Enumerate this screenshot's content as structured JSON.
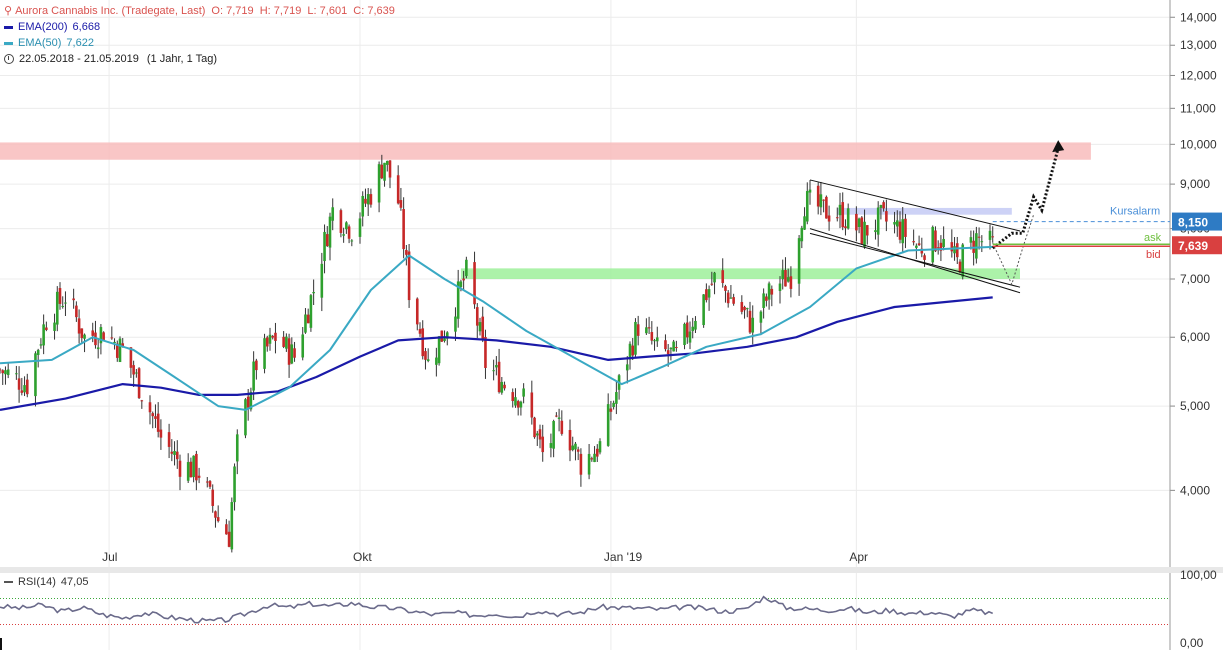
{
  "header": {
    "title": "Aurora Cannabis Inc. (Tradegate, Last)",
    "ohlc": "O: 7,719  H: 7,719  L: 7,601  C: 7,639",
    "ema200_label": "EMA(200)",
    "ema200_value": "6,668",
    "ema50_label": "EMA(50)",
    "ema50_value": "7,622",
    "date_range": "22.05.2018 - 21.05.2019",
    "period": "(1 Jahr, 1 Tag)"
  },
  "colors": {
    "title": "#d9534f",
    "ema200": "#1a1aa8",
    "ema50": "#3aa9c4",
    "up": "#2ea02e",
    "down": "#c62828",
    "resistance_zone": "#f8bcbc",
    "support_zone": "#9ef09a",
    "kursalarm": "#4a8fd8",
    "ask": "#6fbf3f",
    "bid": "#d94040",
    "rsi": "#6a6a8a"
  },
  "chart_data": [
    {
      "type": "candlestick",
      "title": "Aurora Cannabis Inc. (Tradegate, Last)",
      "y_scale": "log",
      "ylim": [
        3.3,
        14.5
      ],
      "y_ticks": [
        "14,000",
        "13,000",
        "12,000",
        "11,000",
        "10,000",
        "9,000",
        "8,000",
        "7,000",
        "6,000",
        "5,000",
        "4,000"
      ],
      "y_tick_values": [
        14,
        13,
        12,
        11,
        10,
        9,
        8,
        7,
        6,
        5,
        4
      ],
      "x_tick_labels": [
        "Jul",
        "Okt",
        "Jan '19",
        "Apr"
      ],
      "x_tick_dates": [
        "2018-07-01",
        "2018-10-01",
        "2019-01-01",
        "2019-04-01"
      ],
      "xlim": [
        "2018-05-22",
        "2019-07-25"
      ],
      "price_path": [
        [
          "2018-05-22",
          5.5
        ],
        [
          "2018-06-01",
          5.3
        ],
        [
          "2018-06-08",
          6.3
        ],
        [
          "2018-06-15",
          6.7
        ],
        [
          "2018-06-22",
          6.0
        ],
        [
          "2018-06-29",
          6.1
        ],
        [
          "2018-07-06",
          5.8
        ],
        [
          "2018-07-13",
          5.2
        ],
        [
          "2018-07-20",
          4.6
        ],
        [
          "2018-07-27",
          4.3
        ],
        [
          "2018-08-03",
          4.2
        ],
        [
          "2018-08-10",
          3.7
        ],
        [
          "2018-08-14",
          3.55
        ],
        [
          "2018-08-17",
          4.5
        ],
        [
          "2018-08-24",
          5.6
        ],
        [
          "2018-08-31",
          6.0
        ],
        [
          "2018-09-07",
          5.7
        ],
        [
          "2018-09-14",
          6.8
        ],
        [
          "2018-09-21",
          8.4
        ],
        [
          "2018-09-28",
          8.0
        ],
        [
          "2018-10-05",
          8.8
        ],
        [
          "2018-10-10",
          9.6
        ],
        [
          "2018-10-15",
          8.6
        ],
        [
          "2018-10-19",
          6.8
        ],
        [
          "2018-10-26",
          5.6
        ],
        [
          "2018-11-02",
          6.2
        ],
        [
          "2018-11-09",
          7.1
        ],
        [
          "2018-11-16",
          5.6
        ],
        [
          "2018-11-23",
          5.3
        ],
        [
          "2018-11-30",
          5.1
        ],
        [
          "2018-12-07",
          4.4
        ],
        [
          "2018-12-14",
          4.8
        ],
        [
          "2018-12-21",
          4.3
        ],
        [
          "2018-12-28",
          4.5
        ],
        [
          "2019-01-04",
          5.3
        ],
        [
          "2019-01-11",
          6.2
        ],
        [
          "2019-01-18",
          5.8
        ],
        [
          "2019-01-25",
          5.7
        ],
        [
          "2019-02-01",
          6.4
        ],
        [
          "2019-02-08",
          7.0
        ],
        [
          "2019-02-15",
          6.6
        ],
        [
          "2019-02-22",
          6.2
        ],
        [
          "2019-03-01",
          6.8
        ],
        [
          "2019-03-08",
          7.1
        ],
        [
          "2019-03-13",
          8.6
        ],
        [
          "2019-03-20",
          8.4
        ],
        [
          "2019-03-27",
          8.3
        ],
        [
          "2019-04-03",
          7.9
        ],
        [
          "2019-04-10",
          8.2
        ],
        [
          "2019-04-17",
          8.0
        ],
        [
          "2019-04-24",
          7.6
        ],
        [
          "2019-05-01",
          7.8
        ],
        [
          "2019-05-08",
          7.3
        ],
        [
          "2019-05-15",
          7.8
        ],
        [
          "2019-05-21",
          7.639
        ]
      ],
      "series": [
        {
          "name": "EMA(200)",
          "points": [
            [
              "2018-05-22",
              4.95
            ],
            [
              "2018-06-15",
              5.1
            ],
            [
              "2018-07-06",
              5.3
            ],
            [
              "2018-07-20",
              5.25
            ],
            [
              "2018-08-03",
              5.15
            ],
            [
              "2018-08-17",
              5.15
            ],
            [
              "2018-09-01",
              5.2
            ],
            [
              "2018-09-15",
              5.4
            ],
            [
              "2018-10-01",
              5.7
            ],
            [
              "2018-10-15",
              5.95
            ],
            [
              "2018-11-01",
              6.0
            ],
            [
              "2018-11-20",
              5.95
            ],
            [
              "2018-12-10",
              5.85
            ],
            [
              "2018-12-31",
              5.65
            ],
            [
              "2019-01-15",
              5.7
            ],
            [
              "2019-02-01",
              5.75
            ],
            [
              "2019-02-20",
              5.85
            ],
            [
              "2019-03-10",
              6.0
            ],
            [
              "2019-03-25",
              6.25
            ],
            [
              "2019-04-15",
              6.5
            ],
            [
              "2019-05-21",
              6.668
            ]
          ]
        },
        {
          "name": "EMA(50)",
          "points": [
            [
              "2018-05-22",
              5.6
            ],
            [
              "2018-06-10",
              5.65
            ],
            [
              "2018-06-25",
              6.0
            ],
            [
              "2018-07-10",
              5.8
            ],
            [
              "2018-07-25",
              5.4
            ],
            [
              "2018-08-10",
              5.0
            ],
            [
              "2018-08-20",
              4.95
            ],
            [
              "2018-09-05",
              5.25
            ],
            [
              "2018-09-20",
              5.8
            ],
            [
              "2018-10-05",
              6.8
            ],
            [
              "2018-10-19",
              7.45
            ],
            [
              "2018-11-01",
              7.0
            ],
            [
              "2018-11-15",
              6.6
            ],
            [
              "2018-12-01",
              6.1
            ],
            [
              "2018-12-20",
              5.65
            ],
            [
              "2019-01-05",
              5.3
            ],
            [
              "2019-01-20",
              5.55
            ],
            [
              "2019-02-05",
              5.85
            ],
            [
              "2019-02-25",
              6.05
            ],
            [
              "2019-03-15",
              6.5
            ],
            [
              "2019-04-01",
              7.2
            ],
            [
              "2019-04-20",
              7.55
            ],
            [
              "2019-05-21",
              7.622
            ]
          ]
        }
      ],
      "zones": [
        {
          "type": "resistance",
          "y_low": 9.6,
          "y_high": 10.05,
          "x_start": "2018-05-22",
          "x_end": "2019-06-26"
        },
        {
          "type": "support",
          "y_low": 7.0,
          "y_high": 7.2,
          "x_start": "2018-11-07",
          "x_end": "2019-05-31"
        },
        {
          "type": "target",
          "y_low": 8.3,
          "y_high": 8.45,
          "x_start": "2019-03-25",
          "x_end": "2019-05-28"
        }
      ],
      "channel": {
        "upper": [
          [
            "2019-03-15",
            9.1
          ],
          [
            "2019-05-31",
            7.95
          ]
        ],
        "lower": [
          [
            "2019-03-15",
            8.0
          ],
          [
            "2019-05-31",
            6.75
          ]
        ],
        "inner": [
          [
            "2019-03-15",
            7.9
          ],
          [
            "2019-05-31",
            6.85
          ]
        ]
      },
      "scenario_path": [
        [
          "2019-05-21",
          7.6
        ],
        [
          "2019-05-28",
          7.9
        ],
        [
          "2019-06-01",
          7.9
        ],
        [
          "2019-06-05",
          8.7
        ],
        [
          "2019-06-08",
          8.4
        ],
        [
          "2019-06-14",
          9.9
        ]
      ],
      "alt_path": [
        [
          "2019-05-21",
          7.7
        ],
        [
          "2019-05-28",
          6.9
        ],
        [
          "2019-06-01",
          7.6
        ],
        [
          "2019-06-05",
          8.3
        ]
      ],
      "price_lines": [
        {
          "label": "Kursalarm",
          "value": "8,150",
          "y": 8.15
        },
        {
          "label": "ask",
          "value": "7,639",
          "y": 7.655
        },
        {
          "label": "bid",
          "value": "7,639",
          "y": 7.639
        }
      ]
    },
    {
      "type": "line",
      "title": "RSI(14)",
      "value": "47,05",
      "ylim": [
        0,
        100
      ],
      "y_ticks": [
        "100,00",
        "0,00"
      ],
      "overbought": 70,
      "oversold": 30,
      "values_by_week": [
        58,
        55,
        60,
        50,
        56,
        45,
        40,
        48,
        42,
        38,
        35,
        37,
        48,
        60,
        56,
        62,
        58,
        63,
        57,
        55,
        50,
        45,
        48,
        44,
        47,
        42,
        52,
        46,
        48,
        57,
        56,
        55,
        53,
        57,
        55,
        50,
        53,
        73,
        56,
        54,
        52,
        55,
        48,
        52,
        47,
        49,
        42,
        52,
        47.05
      ]
    }
  ]
}
